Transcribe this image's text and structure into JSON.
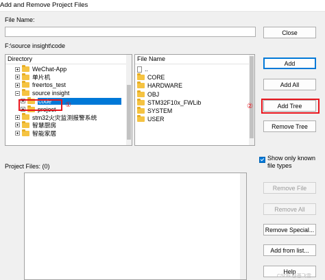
{
  "window": {
    "title": "Add and Remove Project Files"
  },
  "file_name": {
    "label": "File Name:",
    "value": ""
  },
  "current_path": "F:\\source insight\\code",
  "directory": {
    "header": "Directory",
    "items": [
      {
        "label": "WeChat-App",
        "expander": "plus"
      },
      {
        "label": "单片机",
        "expander": "plus"
      },
      {
        "label": "freertos_test",
        "expander": "plus"
      },
      {
        "label": "source insight",
        "expander": "minus"
      },
      {
        "label": "code",
        "expander": "plus",
        "selected": true
      },
      {
        "label": "project",
        "expander": "plus"
      },
      {
        "label": "stm32火灾监测报警系统",
        "expander": "plus"
      },
      {
        "label": "智慧厨房",
        "expander": "plus"
      },
      {
        "label": "智能家居",
        "expander": "plus"
      }
    ]
  },
  "file_list": {
    "header": "File Name",
    "items": [
      {
        "label": "..",
        "icon": "file-icon"
      },
      {
        "label": "CORE",
        "icon": "folder-icon"
      },
      {
        "label": "HARDWARE",
        "icon": "folder-icon"
      },
      {
        "label": "OBJ",
        "icon": "folder-icon"
      },
      {
        "label": "STM32F10x_FWLib",
        "icon": "folder-icon"
      },
      {
        "label": "SYSTEM",
        "icon": "folder-icon"
      },
      {
        "label": "USER",
        "icon": "folder-icon"
      }
    ]
  },
  "buttons": {
    "close": "Close",
    "add": "Add",
    "add_all": "Add All",
    "add_tree": "Add Tree",
    "remove_tree": "Remove Tree",
    "remove_file": "Remove File",
    "remove_all": "Remove All",
    "remove_special": "Remove Special...",
    "add_from_list": "Add from list...",
    "help": "Help"
  },
  "options": {
    "show_only_known": "Show only known file types",
    "show_only_known_checked": true
  },
  "project_files": {
    "label": "Project Files: (0)",
    "count": 0
  },
  "annotations": {
    "marker_1": "①",
    "marker_2": "②",
    "color": "#e8141c"
  },
  "watermark": "CSDN @基飞雪",
  "colors": {
    "accent": "#0078d7",
    "folder": "#f5c342"
  }
}
